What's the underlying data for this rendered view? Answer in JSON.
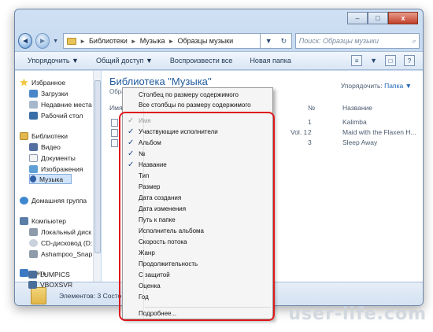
{
  "window": {
    "caption_minimize": "–",
    "caption_maximize": "□",
    "caption_close": "x"
  },
  "address": {
    "back_glyph": "◄",
    "forward_glyph": "►",
    "crumbs": [
      "Библиотеки",
      "Музыка",
      "Образцы музыки"
    ],
    "separator": "►",
    "dropdown_glyph": "▼",
    "refresh_glyph": "↻",
    "search_placeholder": "Поиск: Образцы музыки",
    "search_glyph": "⌕"
  },
  "toolbar": {
    "organize": "Упорядочить ▼",
    "share": "Общий доступ ▼",
    "play_all": "Воспроизвести все",
    "new_folder": "Новая папка",
    "view_glyph": "≡",
    "preview_glyph": "□",
    "help_glyph": "?"
  },
  "nav": {
    "favorites": "Избранное",
    "downloads": "Загрузки",
    "recent": "Недавние места",
    "desktop": "Рабочий стол",
    "libraries": "Библиотеки",
    "video": "Видео",
    "documents": "Документы",
    "images": "Изображения",
    "music": "Музыка",
    "homegroup": "Домашняя группа",
    "computer": "Компьютер",
    "local_disk": "Локальный диск",
    "cd_drive": "CD-дисковод (D:",
    "ashampoo": "Ashampoo_Snap",
    "network": "Сеть",
    "pc1": "LUMPICS",
    "pc2": "VBOXSVR"
  },
  "content": {
    "title": "Библиотека \"Музыка\"",
    "subtitle": "Образцы музыки",
    "arrange_label": "Упорядочить:",
    "arrange_value": "Папка ▼",
    "col_name": "Имя",
    "col_num": "№",
    "col_title": "Название",
    "album_fragment": "Vol. 1",
    "tracks": [
      {
        "num": "1",
        "title": "Kalimba"
      },
      {
        "num": "2",
        "title": "Maid with the Flaxen H..."
      },
      {
        "num": "3",
        "title": "Sleep Away"
      }
    ]
  },
  "status": {
    "count": "Элементов: 3  Состо"
  },
  "menu": {
    "fit_column": "Столбец по размеру содержимого",
    "fit_all": "Все столбцы по размеру содержимого",
    "check_glyph": "✓",
    "items": [
      {
        "label": "Имя",
        "checked": true,
        "disabled": true
      },
      {
        "label": "Участвующие исполнители",
        "checked": true,
        "disabled": false
      },
      {
        "label": "Альбом",
        "checked": true,
        "disabled": false
      },
      {
        "label": "№",
        "checked": true,
        "disabled": false
      },
      {
        "label": "Название",
        "checked": true,
        "disabled": false
      },
      {
        "label": "Тип",
        "checked": false,
        "disabled": false
      },
      {
        "label": "Размер",
        "checked": false,
        "disabled": false
      },
      {
        "label": "Дата создания",
        "checked": false,
        "disabled": false
      },
      {
        "label": "Дата изменения",
        "checked": false,
        "disabled": false
      },
      {
        "label": "Путь к папке",
        "checked": false,
        "disabled": false
      },
      {
        "label": "Исполнитель альбома",
        "checked": false,
        "disabled": false
      },
      {
        "label": "Скорость потока",
        "checked": false,
        "disabled": false
      },
      {
        "label": "Жанр",
        "checked": false,
        "disabled": false
      },
      {
        "label": "Продолжительность",
        "checked": false,
        "disabled": false
      },
      {
        "label": "С защитой",
        "checked": false,
        "disabled": false
      },
      {
        "label": "Оценка",
        "checked": false,
        "disabled": false
      },
      {
        "label": "Год",
        "checked": false,
        "disabled": false
      }
    ],
    "more": "Подробнее..."
  },
  "watermark": "user-life.com",
  "colors": {
    "highlight": "#e0191d",
    "accent": "#1e5a9c"
  }
}
